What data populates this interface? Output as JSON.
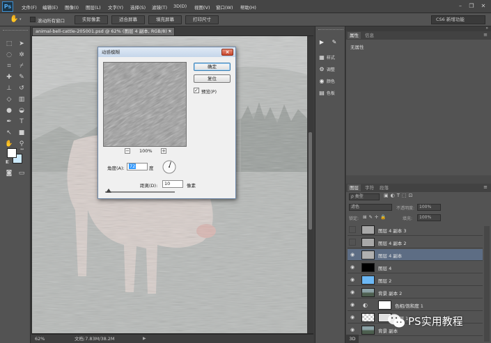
{
  "app": {
    "logo": "Ps"
  },
  "menu": [
    "文件(F)",
    "编辑(E)",
    "图像(I)",
    "图层(L)",
    "文字(Y)",
    "选择(S)",
    "滤镜(T)",
    "3D(D)",
    "视图(V)",
    "窗口(W)",
    "帮助(H)"
  ],
  "window_controls": {
    "minimize": "–",
    "restore": "❐",
    "close": "✕"
  },
  "options": {
    "scroll_all_label": "滚动所有窗口",
    "buttons": [
      "实际像素",
      "适合屏幕",
      "填充屏幕",
      "打印尺寸"
    ],
    "workspace": "CS6 新增功能"
  },
  "document": {
    "tab": "animal-bell-cattle-205001.psd @ 62% (图层 4 副本, RGB/8) *",
    "tab_close": "×",
    "zoom": "62%",
    "doc_info": "文档:7.83M/38.2M"
  },
  "dialog": {
    "title": "动感模糊",
    "close": "×",
    "ok": "确定",
    "reset": "复位",
    "preview_label": "预览(P)",
    "preview_checked": true,
    "zoom": "100%",
    "zoom_minus": "−",
    "zoom_plus": "+",
    "angle_label": "角度(A):",
    "angle_value": "72",
    "angle_unit": "度",
    "distance_label": "距离(D):",
    "distance_value": "10",
    "distance_unit": "像素"
  },
  "icon_strip": [
    {
      "icon": "play-icon",
      "glyph": "▶",
      "label": ""
    },
    {
      "icon": "brush-presets-icon",
      "glyph": "✎",
      "label": ""
    },
    {
      "icon": "styles-icon",
      "glyph": "▦",
      "label": "样式"
    },
    {
      "icon": "adjustments-icon",
      "glyph": "⚙",
      "label": "调整"
    },
    {
      "icon": "swatches-icon",
      "glyph": "◉",
      "label": "颜色"
    },
    {
      "icon": "swatch-grid-icon",
      "glyph": "▤",
      "label": "色板"
    }
  ],
  "properties": {
    "tabs": [
      "属性",
      "信息"
    ],
    "empty_text": "无属性"
  },
  "layers_panel": {
    "tabs": [
      "图层",
      "字符",
      "段落"
    ],
    "filter": "ρ 类型",
    "blend_mode": "滤色",
    "opacity_label": "不透明度:",
    "opacity_value": "100%",
    "lock_label": "锁定:",
    "fill_label": "填充:",
    "fill_value": "100%",
    "layers": [
      {
        "name": "图层 4 副本 3",
        "visible": false,
        "thumb": "#a8a8a8",
        "selected": false
      },
      {
        "name": "图层 4 副本 2",
        "visible": false,
        "thumb": "#a8a8a8",
        "selected": false
      },
      {
        "name": "图层 4 副本",
        "visible": true,
        "thumb": "#b0b0b0",
        "selected": true
      },
      {
        "name": "图层 4",
        "visible": true,
        "thumb": "#000000",
        "selected": false
      },
      {
        "name": "图层 2",
        "visible": true,
        "thumb": "#6cb8f5",
        "selected": false
      },
      {
        "name": "背景 副本 2",
        "visible": true,
        "thumb": "#6f7e72",
        "selected": false
      },
      {
        "name": "色相/饱和度 1",
        "visible": true,
        "thumb": "#ffffff",
        "selected": false
      },
      {
        "name": "图层 1",
        "visible": true,
        "thumb": "#d9d9d9",
        "selected": false
      },
      {
        "name": "背景 副本",
        "visible": true,
        "thumb": "#6f7e72",
        "selected": false
      }
    ]
  },
  "bottom_tab": "3D",
  "watermark": "PS实用教程"
}
